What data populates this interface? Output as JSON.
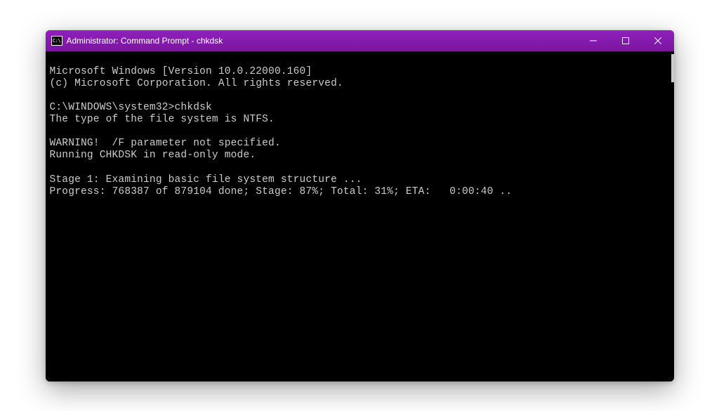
{
  "titlebar": {
    "title": "Administrator: Command Prompt - chkdsk"
  },
  "terminal": {
    "line1": "Microsoft Windows [Version 10.0.22000.160]",
    "line2": "(c) Microsoft Corporation. All rights reserved.",
    "blank1": "",
    "prompt_line": "C:\\WINDOWS\\system32>chkdsk",
    "fs_line": "The type of the file system is NTFS.",
    "blank2": "",
    "warning_line": "WARNING!  /F parameter not specified.",
    "mode_line": "Running CHKDSK in read-only mode.",
    "blank3": "",
    "stage_line": "Stage 1: Examining basic file system structure ...",
    "progress_line": "Progress: 768387 of 879104 done; Stage: 87%; Total: 31%; ETA:   0:00:40 .."
  }
}
